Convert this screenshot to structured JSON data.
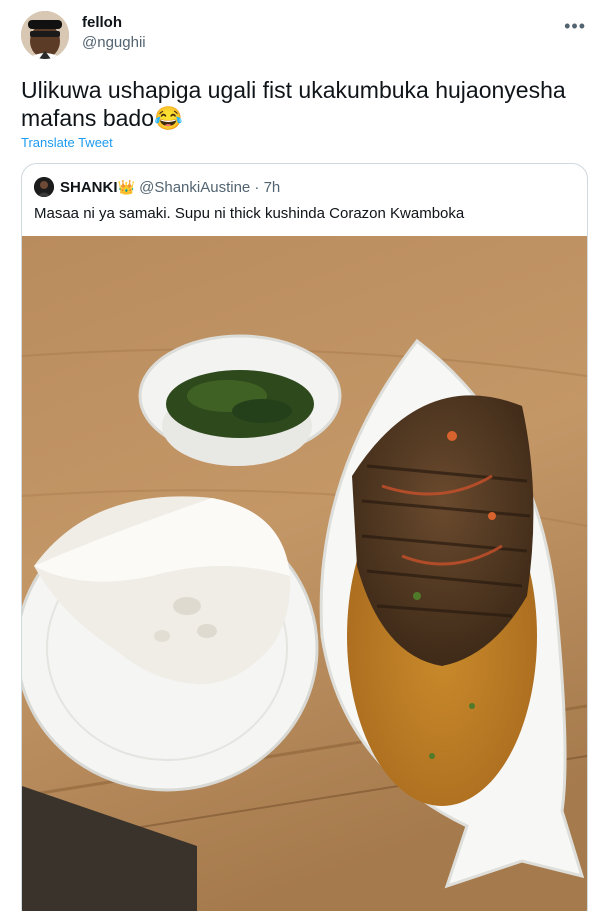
{
  "tweet": {
    "display_name": "felloh",
    "handle": "@ngughii",
    "more_label": "•••",
    "text": "Ulikuwa ushapiga ugali fist ukakumbuka hujaonyesha mafans bado😂",
    "translate_label": "Translate Tweet"
  },
  "quoted_tweet": {
    "display_name": "SHANKI",
    "name_emoji": "👑",
    "handle": "@ShankiAustine",
    "separator": "·",
    "time": "7h",
    "text": "Masaa ni ya samaki. Supu ni thick kushinda Corazon Kwamboka"
  },
  "colors": {
    "link": "#1d9bf0",
    "secondary_text": "#536471",
    "border": "#cfd9de"
  }
}
